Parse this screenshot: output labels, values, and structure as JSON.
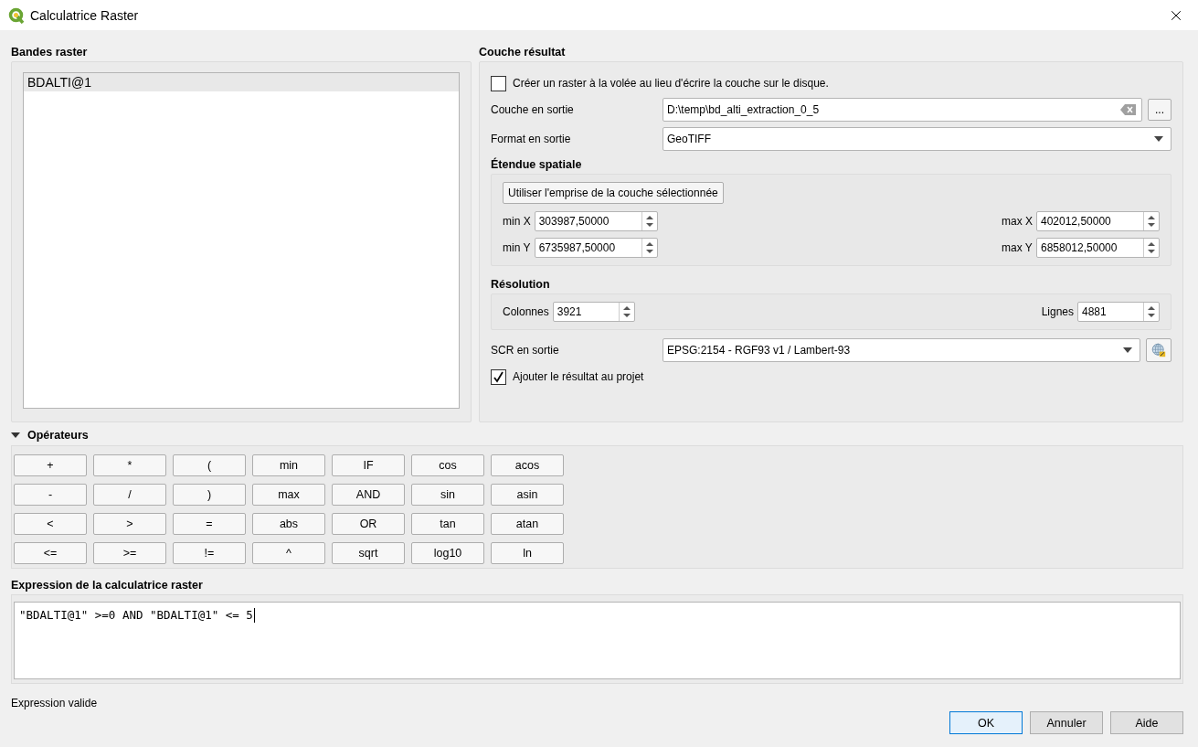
{
  "window": {
    "title": "Calculatrice Raster"
  },
  "raster_bands": {
    "title": "Bandes raster",
    "items": [
      {
        "label": "BDALTI@1",
        "selected": true
      }
    ]
  },
  "result_layer": {
    "title": "Couche résultat",
    "on_the_fly": {
      "label": "Créer un raster à la volée au lieu d'écrire la couche sur le disque.",
      "checked": false
    },
    "output_layer": {
      "label": "Couche en sortie",
      "value": "D:\\temp\\bd_alti_extraction_0_5",
      "browse": "..."
    },
    "output_format": {
      "label": "Format en sortie",
      "value": "GeoTIFF"
    },
    "spatial_extent": {
      "title": "Étendue spatiale",
      "button": "Utiliser l'emprise de la couche sélectionnée",
      "fields": [
        {
          "label": "min X",
          "value": "303987,50000"
        },
        {
          "label": "max X",
          "value": "402012,50000"
        },
        {
          "label": "min Y",
          "value": "6735987,50000"
        },
        {
          "label": "max Y",
          "value": "6858012,50000"
        }
      ]
    },
    "resolution": {
      "title": "Résolution",
      "fields": [
        {
          "label": "Colonnes",
          "value": "3921"
        },
        {
          "label": "Lignes",
          "value": "4881"
        }
      ]
    },
    "output_crs": {
      "label": "SCR en sortie",
      "value": "EPSG:2154 - RGF93 v1 / Lambert-93"
    },
    "add_to_project": {
      "label": "Ajouter le résultat au projet",
      "checked": true
    }
  },
  "operators": {
    "title": "Opérateurs",
    "expanded": true,
    "buttons": [
      "+",
      "*",
      "(",
      "min",
      "IF",
      "cos",
      "acos",
      "-",
      "/",
      ")",
      "max",
      "AND",
      "sin",
      "asin",
      "<",
      ">",
      "=",
      "abs",
      "OR",
      "tan",
      "atan",
      "<=",
      ">=",
      "!=",
      "^",
      "sqrt",
      "log10",
      "ln"
    ]
  },
  "expression": {
    "title": "Expression de la calculatrice raster",
    "value": "\"BDALTI@1\" >=0 AND \"BDALTI@1\" <= 5",
    "status": "Expression valide"
  },
  "buttons": [
    {
      "label": "OK",
      "default": true
    },
    {
      "label": "Annuler",
      "default": false
    },
    {
      "label": "Aide",
      "default": false
    }
  ]
}
